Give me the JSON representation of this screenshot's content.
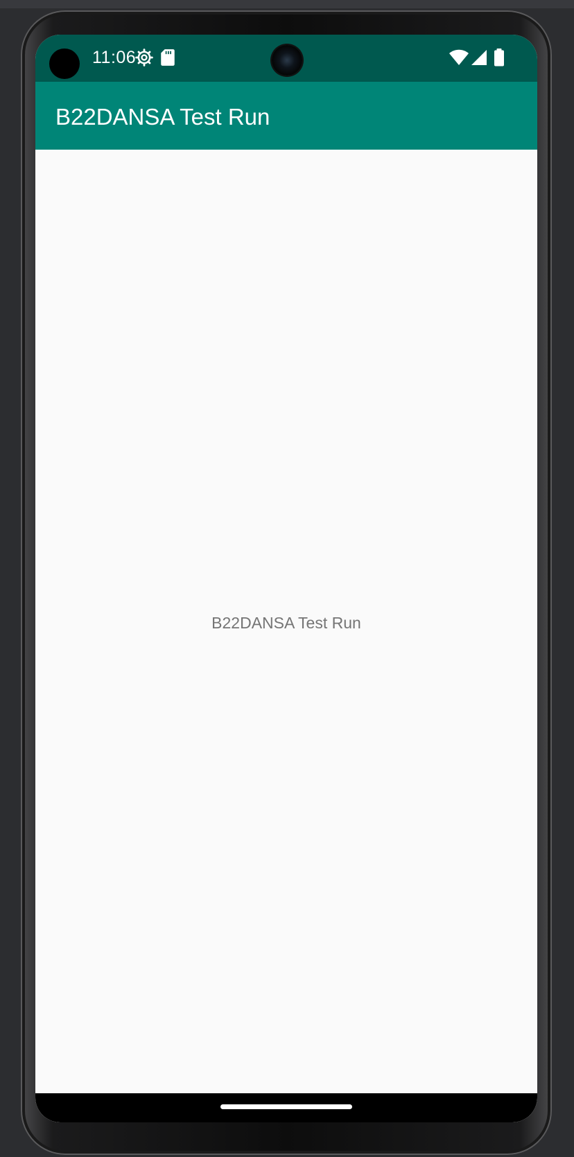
{
  "status_bar": {
    "time": "11:06",
    "icons": [
      "settings-gear-icon",
      "sd-card-icon",
      "wifi-icon",
      "cellular-signal-icon",
      "battery-icon"
    ],
    "background": "#00594f"
  },
  "app_bar": {
    "title": "B22DANSA Test Run",
    "background": "#008577"
  },
  "main": {
    "text": "B22DANSA Test Run",
    "text_color": "#757575"
  },
  "navigation": {
    "gesture": "home-handle"
  }
}
